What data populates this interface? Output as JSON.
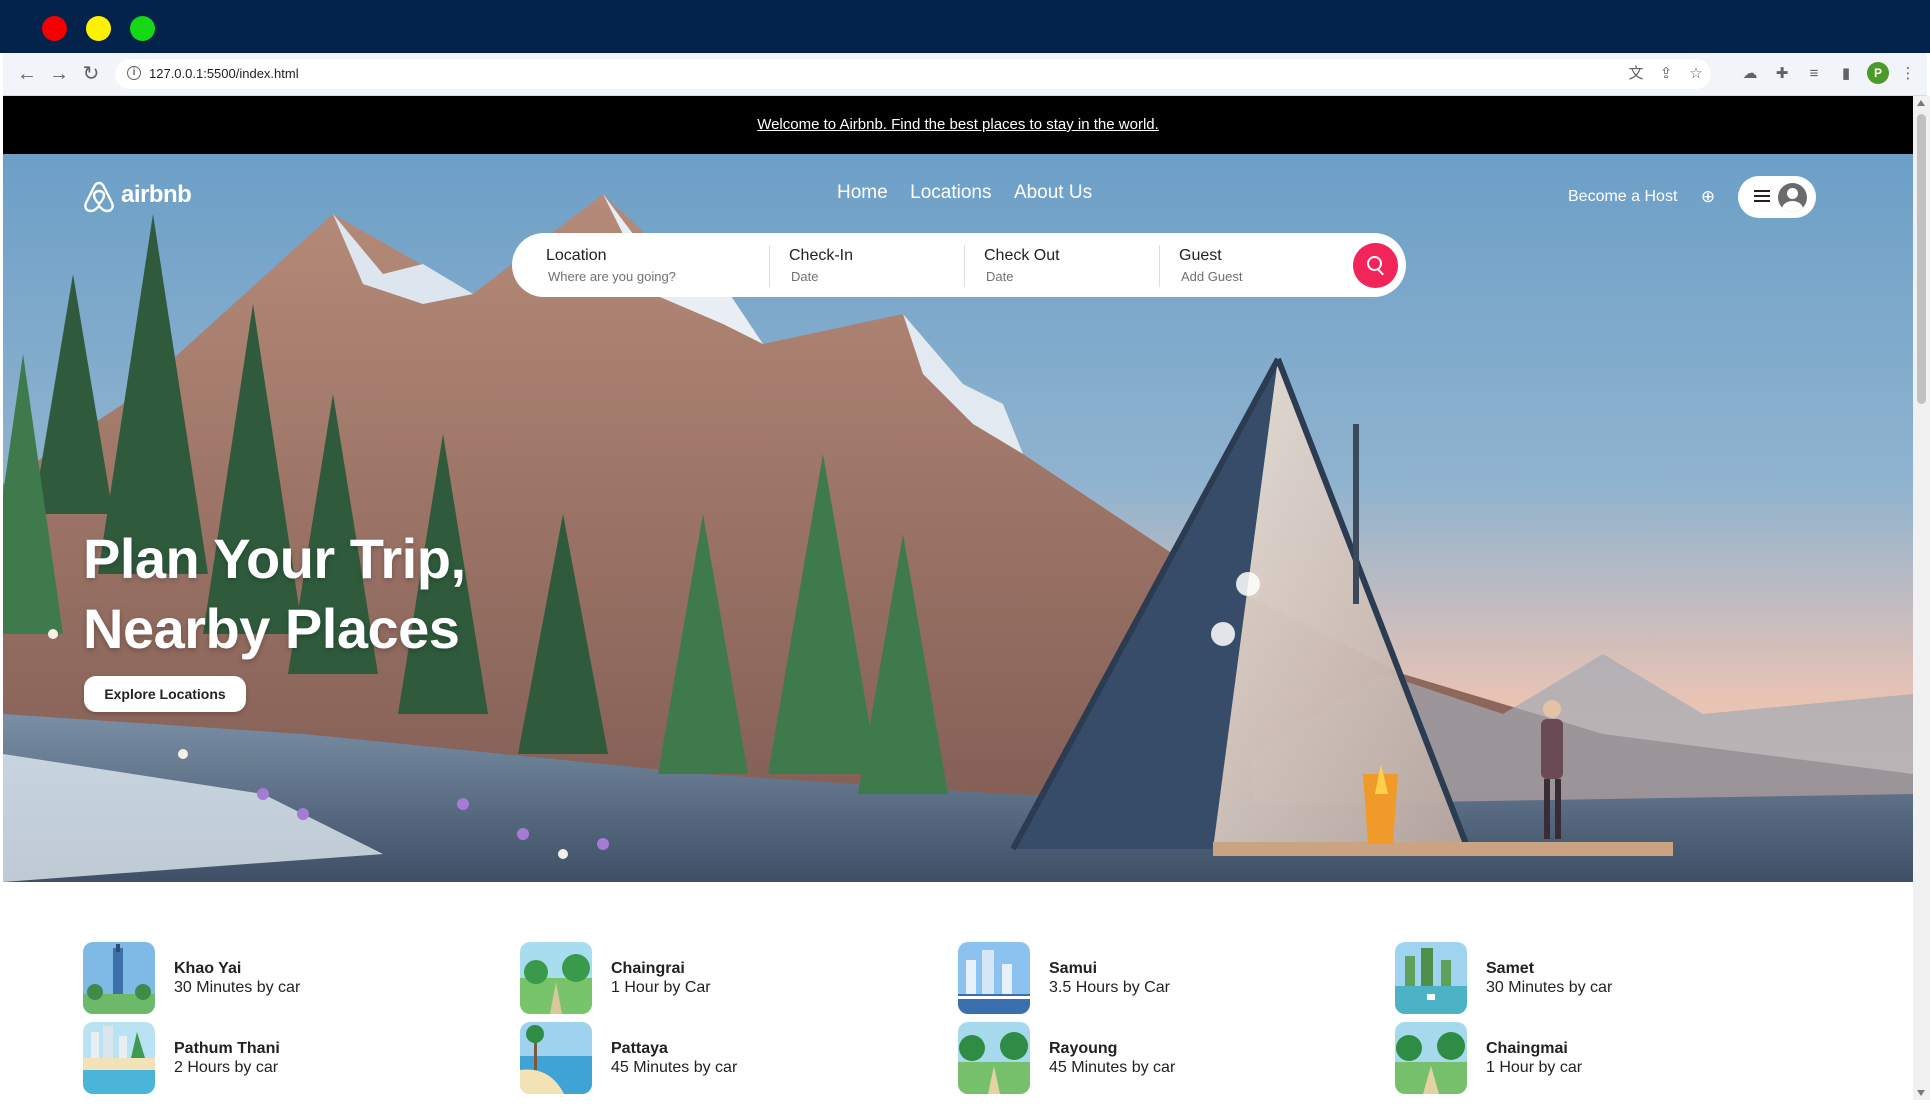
{
  "browser": {
    "url": "127.0.0.1:5500/index.html",
    "profile_initial": "P"
  },
  "announcement": "Welcome to Airbnb. Find the best places to stay in the world.",
  "header": {
    "logo_text": "airbnb",
    "nav": [
      "Home",
      "Locations",
      "About Us"
    ],
    "become_host": "Become a Host"
  },
  "search": {
    "location": {
      "label": "Location",
      "placeholder": "Where are you going?"
    },
    "checkin": {
      "label": "Check-In",
      "placeholder": "Date"
    },
    "checkout": {
      "label": "Check Out",
      "placeholder": "Date"
    },
    "guest": {
      "label": "Guest",
      "placeholder": "Add Guest"
    },
    "button_color": "#f2255a"
  },
  "hero": {
    "title_line1": "Plan Your Trip,",
    "title_line2": "Nearby Places",
    "cta": "Explore Locations"
  },
  "places": [
    {
      "name": "Khao Yai",
      "distance": "30 Minutes by car"
    },
    {
      "name": "Chaingrai",
      "distance": "1 Hour by Car"
    },
    {
      "name": "Samui",
      "distance": "3.5 Hours by Car"
    },
    {
      "name": "Samet",
      "distance": "30 Minutes by car"
    },
    {
      "name": "Pathum Thani",
      "distance": "2 Hours by car"
    },
    {
      "name": "Pattaya",
      "distance": "45 Minutes by car"
    },
    {
      "name": "Rayoung",
      "distance": "45 Minutes by car"
    },
    {
      "name": "Chaingmai",
      "distance": "1 Hour by car"
    }
  ]
}
